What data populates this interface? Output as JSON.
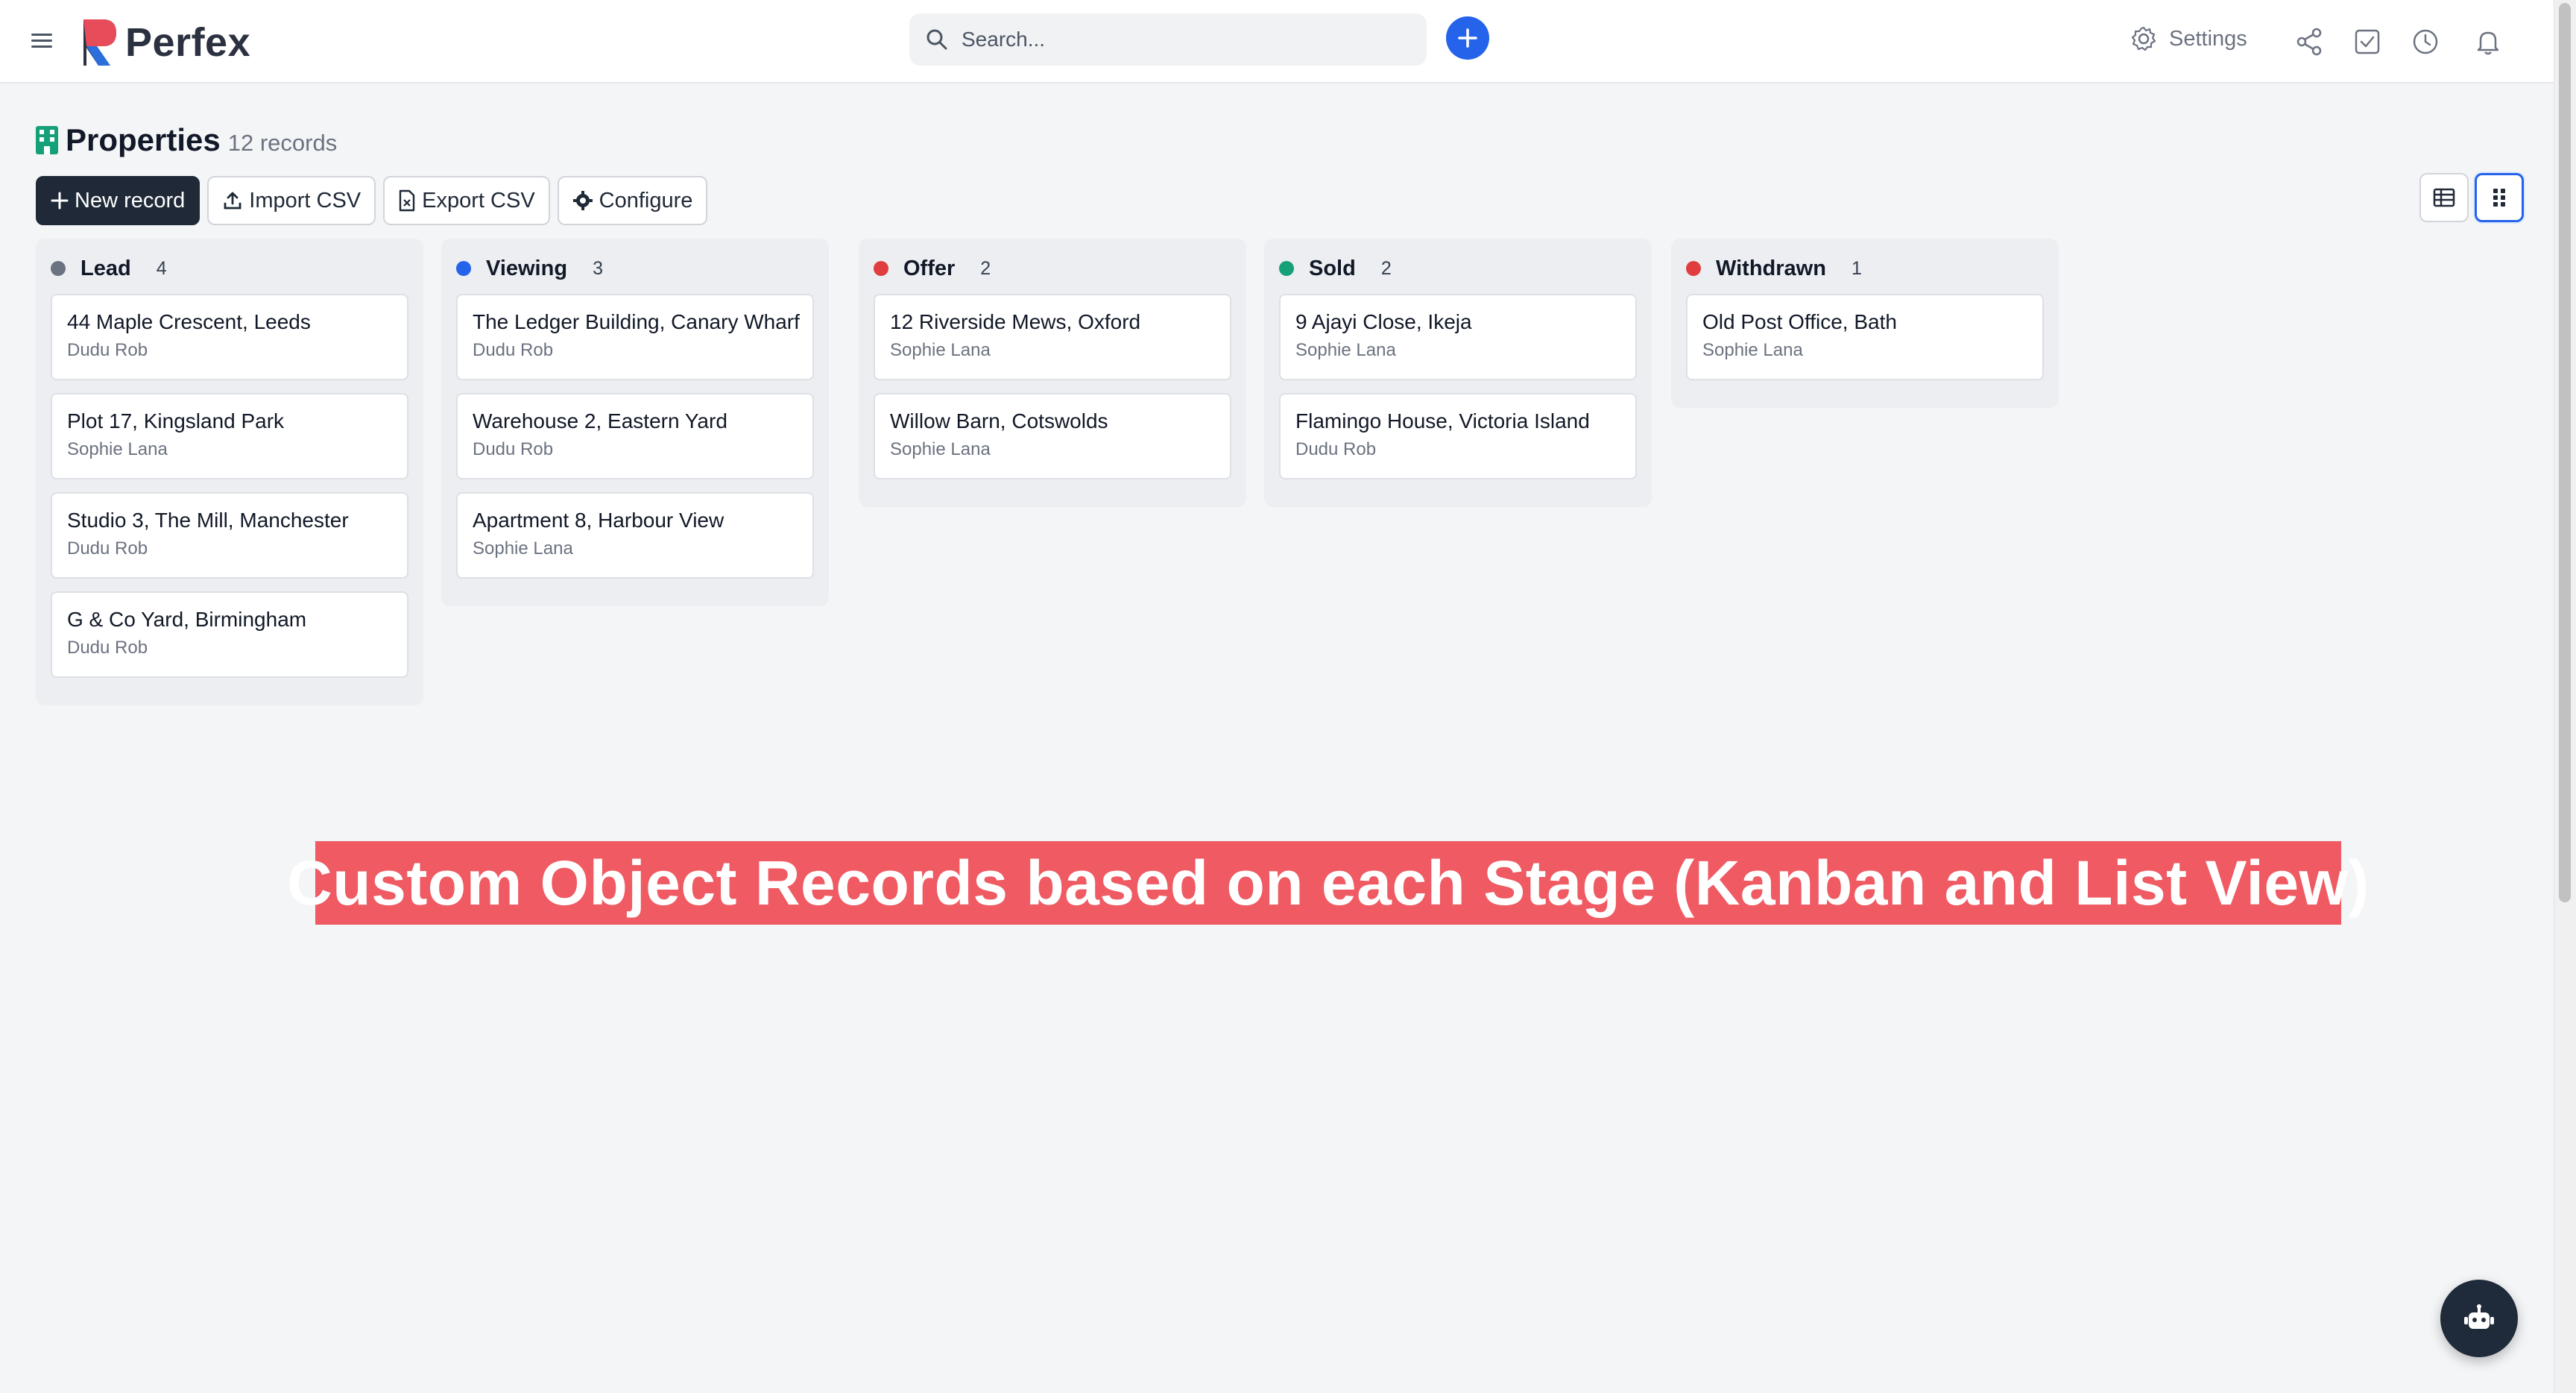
{
  "app": {
    "name": "Perfex"
  },
  "search": {
    "placeholder": "Search..."
  },
  "header_right": {
    "settings_label": "Settings"
  },
  "page": {
    "title": "Properties",
    "record_count": "12 records"
  },
  "toolbar": {
    "new_record": "New record",
    "import_csv": "Import CSV",
    "export_csv": "Export CSV",
    "configure": "Configure"
  },
  "board": {
    "columns": [
      {
        "name": "Lead",
        "count": "4",
        "color": "#6b7280",
        "cards": [
          {
            "title": "44 Maple Crescent, Leeds",
            "owner": "Dudu Rob"
          },
          {
            "title": "Plot 17, Kingsland Park",
            "owner": "Sophie Lana"
          },
          {
            "title": "Studio 3, The Mill, Manchester",
            "owner": "Dudu Rob"
          },
          {
            "title": "G & Co Yard, Birmingham",
            "owner": "Dudu Rob"
          }
        ]
      },
      {
        "name": "Viewing",
        "count": "3",
        "color": "#2563eb",
        "cards": [
          {
            "title": "The Ledger Building, Canary Wharf",
            "owner": "Dudu Rob"
          },
          {
            "title": "Warehouse 2, Eastern Yard",
            "owner": "Dudu Rob"
          },
          {
            "title": "Apartment 8, Harbour View",
            "owner": "Sophie Lana"
          }
        ]
      },
      {
        "name": "Offer",
        "count": "2",
        "color": "#e03e3e",
        "cards": [
          {
            "title": "12 Riverside Mews, Oxford",
            "owner": "Sophie Lana"
          },
          {
            "title": "Willow Barn, Cotswolds",
            "owner": "Sophie Lana"
          }
        ]
      },
      {
        "name": "Sold",
        "count": "2",
        "color": "#16a07a",
        "cards": [
          {
            "title": "9 Ajayi Close, Ikeja",
            "owner": "Sophie Lana"
          },
          {
            "title": "Flamingo House, Victoria Island",
            "owner": "Dudu Rob"
          }
        ]
      },
      {
        "name": "Withdrawn",
        "count": "1",
        "color": "#e03e3e",
        "cards": [
          {
            "title": "Old Post Office, Bath",
            "owner": "Sophie Lana"
          }
        ]
      }
    ]
  },
  "banner": {
    "text": "Custom Object Records based on each Stage (Kanban and List View)"
  },
  "colors": {
    "primary": "#2563eb",
    "dark": "#1f2937",
    "banner": "#ef5a63"
  },
  "icons": [
    "menu-icon",
    "logo-icon",
    "search-icon",
    "plus-icon",
    "gear-icon",
    "share-icon",
    "task-icon",
    "clock-icon",
    "bell-icon",
    "building-icon",
    "upload-icon",
    "file-icon",
    "cog-icon",
    "table-view-icon",
    "kanban-view-icon",
    "robot-icon"
  ]
}
